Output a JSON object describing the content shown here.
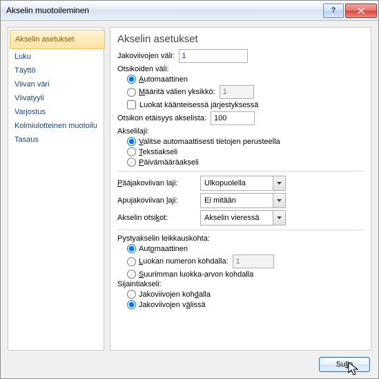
{
  "title": "Akselin muotoileminen",
  "sidebar": {
    "items": [
      "Akselin asetukset",
      "Luku",
      "Täyttö",
      "Viivan väri",
      "Viivatyyli",
      "Varjostus",
      "Kolmiulotteinen muotoilu",
      "Tasaus"
    ]
  },
  "panel": {
    "heading": "Akselin asetukset",
    "interval_ticks_label": "Jakoviivojen väli:",
    "interval_ticks_value": "1",
    "labels_interval_label": "Otsikoiden väli:",
    "labels_interval_auto_u": "A",
    "labels_interval_auto_rest": "utomaattinen",
    "labels_interval_spec_u": "M",
    "labels_interval_spec_rest": "ääritä välien yksikkö:",
    "labels_interval_spec_value": "1",
    "reverse_label": "Luokat käänteisessä järjestyksessä",
    "label_distance_label": "Otsikon etäisyys akselista:",
    "label_distance_value": "100",
    "axis_type_label": "Akselilaji:",
    "axis_type_auto_u": "V",
    "axis_type_auto_rest": "alitse automaattisesti tietojen perusteella",
    "axis_type_text_u": "T",
    "axis_type_text_rest": "ekstiakseli",
    "axis_type_date_u": "P",
    "axis_type_date_rest": "äivämääräakseli",
    "major_tick_u": "P",
    "major_tick_rest": "ääjakoviivan laji:",
    "major_tick_value": "Ulkopuolella",
    "minor_tick_pre": "Apujakoviivan ",
    "minor_tick_u": "l",
    "minor_tick_rest": "aji:",
    "minor_tick_value": "Ei mitään",
    "axis_labels_pre": "Akselin otsi",
    "axis_labels_u": "k",
    "axis_labels_rest": "ot:",
    "axis_labels_value": "Akselin vieressä",
    "vcross_label": "Pystyakselin leikkauskohta:",
    "vcross_auto_pre": "Aut",
    "vcross_auto_u": "o",
    "vcross_auto_rest": "maattinen",
    "vcross_cat_u": "L",
    "vcross_cat_rest": "uokan numeron kohdalla:",
    "vcross_cat_value": "1",
    "vcross_max_u": "S",
    "vcross_max_rest": "uurimman luokka-arvon kohdalla",
    "pos_label": "Sijaintiakseli:",
    "pos_on_pre": "Jakoviivojen koh",
    "pos_on_u": "d",
    "pos_on_rest": "alla",
    "pos_between_pre": "Jakoviivojen v",
    "pos_between_u": "ä",
    "pos_between_rest": "lissä"
  },
  "footer": {
    "close_pre": "Su",
    "close_u": "l",
    "close_rest": "je"
  }
}
